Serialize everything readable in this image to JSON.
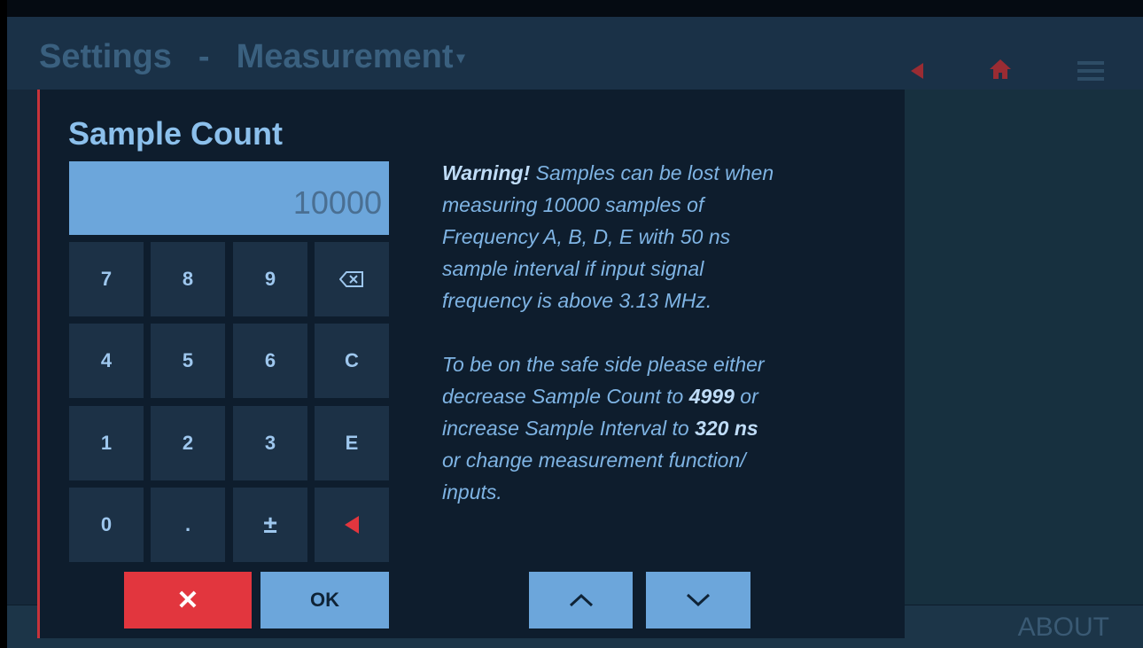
{
  "header": {
    "crumb_settings": "Settings",
    "crumb_sep": "-",
    "crumb_measurement": "Measurement",
    "caret": "▾",
    "icons": [
      "back-icon",
      "home-icon",
      "menu-icon"
    ]
  },
  "footer": {
    "about": "ABOUT"
  },
  "dialog": {
    "title": "Sample Count",
    "value": "10000",
    "keys": {
      "k7": "7",
      "k8": "8",
      "k9": "9",
      "backspace": "⌫",
      "k4": "4",
      "k5": "5",
      "k6": "6",
      "clear": "C",
      "k1": "1",
      "k2": "2",
      "k3": "3",
      "exp": "E",
      "k0": "0",
      "dot": ".",
      "plusminus": "±"
    },
    "cancel_label": "✕",
    "ok_label": "OK",
    "warning": {
      "line1_bold": "Warning!",
      "line1_rest": " Samples can be lost when",
      "line2": "measuring 10000 samples of",
      "line3": "Frequency A, B, D, E with 50 ns",
      "line4": "sample interval if input signal",
      "line5": "frequency is above 3.13 MHz.",
      "line6": "To be on the safe side please either",
      "line7_pre": "decrease Sample Count to ",
      "line7_bold": "4999",
      "line7_post": " or",
      "line8_pre": "increase Sample Interval to ",
      "line8_bold": "320 ns",
      "line9": "or change measurement function/",
      "line10": "inputs."
    }
  },
  "colors": {
    "accent_red": "#e2363e",
    "accent_blue": "#6ca6db",
    "background": "#15283a"
  }
}
